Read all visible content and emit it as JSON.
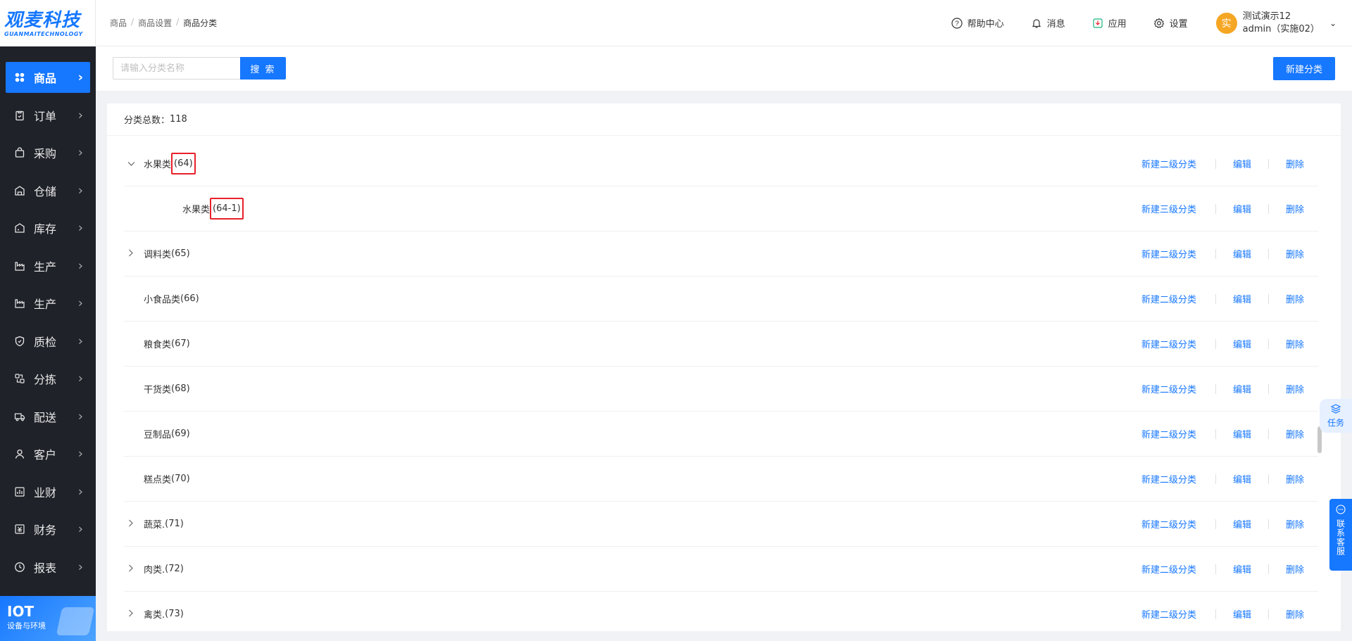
{
  "logo": {
    "main": "观麦科技",
    "sub": "GUANMAITECHNOLOGY"
  },
  "sidebar": {
    "items": [
      {
        "label": "商品",
        "icon": "grid-icon",
        "active": true
      },
      {
        "label": "订单",
        "icon": "clipboard-icon"
      },
      {
        "label": "采购",
        "icon": "bag-icon"
      },
      {
        "label": "仓储",
        "icon": "warehouse-icon"
      },
      {
        "label": "库存",
        "icon": "inventory-icon"
      },
      {
        "label": "生产",
        "icon": "factory-icon"
      },
      {
        "label": "生产",
        "icon": "factory-icon"
      },
      {
        "label": "质检",
        "icon": "shield-icon"
      },
      {
        "label": "分拣",
        "icon": "sort-icon"
      },
      {
        "label": "配送",
        "icon": "truck-icon"
      },
      {
        "label": "客户",
        "icon": "user-icon"
      },
      {
        "label": "业财",
        "icon": "chart-icon"
      },
      {
        "label": "财务",
        "icon": "finance-icon"
      },
      {
        "label": "报表",
        "icon": "clock-icon"
      }
    ],
    "iot": {
      "title": "IOT",
      "subtitle": "设备与环境"
    }
  },
  "header": {
    "breadcrumb": [
      "商品",
      "商品设置",
      "商品分类"
    ],
    "help": "帮助中心",
    "messages": "消息",
    "apps": "应用",
    "settings": "设置",
    "user": {
      "avatar": "实",
      "name": "测试演示12",
      "account": "admin（实施02）"
    }
  },
  "toolbar": {
    "search_placeholder": "请输入分类名称",
    "search_label": "搜 索",
    "new_label": "新建分类"
  },
  "category": {
    "total_label": "分类总数：",
    "total": "118",
    "actions": {
      "add2": "新建二级分类",
      "add3": "新建三级分类",
      "edit": "编辑",
      "delete": "删除"
    },
    "rows": [
      {
        "name": "水果类",
        "code": "(64)",
        "level": 1,
        "toggle": "expanded",
        "highlight": true
      },
      {
        "name": "水果类",
        "code": "(64-1)",
        "level": 2,
        "toggle": "none",
        "highlight": true
      },
      {
        "name": "调料类",
        "code": "(65)",
        "level": 1,
        "toggle": "collapsed"
      },
      {
        "name": "小食品类",
        "code": "(66)",
        "level": 1,
        "toggle": "none"
      },
      {
        "name": "粮食类",
        "code": "(67)",
        "level": 1,
        "toggle": "none"
      },
      {
        "name": "干货类",
        "code": "(68)",
        "level": 1,
        "toggle": "none"
      },
      {
        "name": "豆制品",
        "code": "(69)",
        "level": 1,
        "toggle": "none"
      },
      {
        "name": "糕点类",
        "code": "(70)",
        "level": 1,
        "toggle": "none"
      },
      {
        "name": "蔬菜.",
        "code": "(71)",
        "level": 1,
        "toggle": "collapsed"
      },
      {
        "name": "肉类.",
        "code": "(72)",
        "level": 1,
        "toggle": "collapsed"
      },
      {
        "name": "禽类.",
        "code": "(73)",
        "level": 1,
        "toggle": "collapsed"
      }
    ]
  },
  "widgets": {
    "task": "任务",
    "contact": "联系客服"
  },
  "colors": {
    "primary": "#1677ff",
    "sidebar": "#1f2229",
    "highlight": "#e8202a"
  }
}
